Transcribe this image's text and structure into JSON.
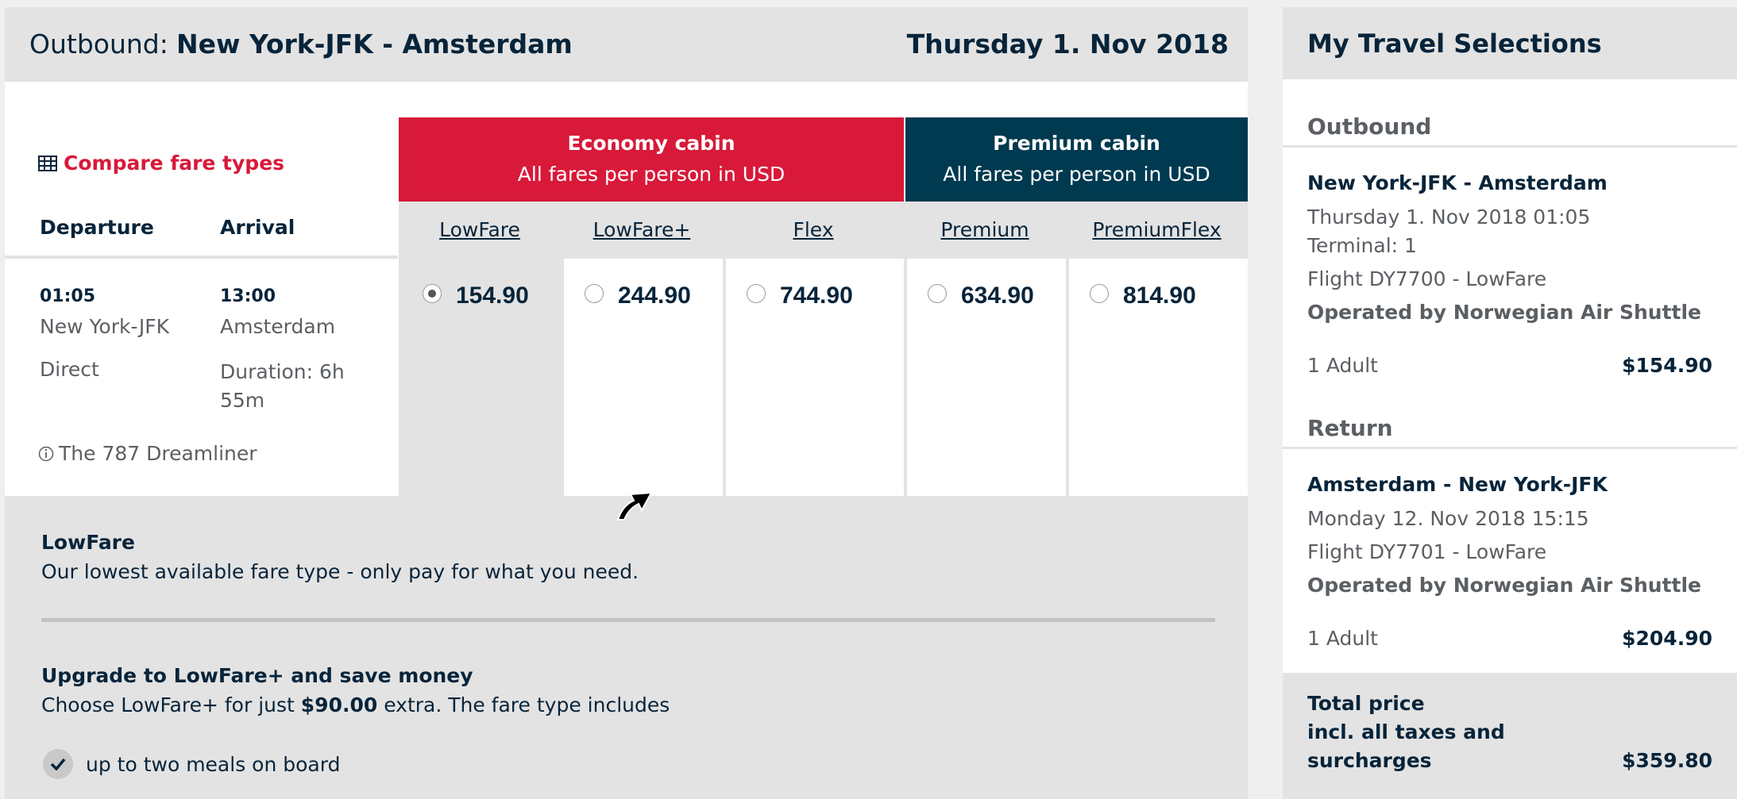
{
  "outbound": {
    "label": "Outbound",
    "route": "New York-JFK - Amsterdam",
    "date": "Thursday 1. Nov 2018"
  },
  "compare_link": "Compare fare types",
  "columns": {
    "departure": "Departure",
    "arrival": "Arrival"
  },
  "flight": {
    "dep_time": "01:05",
    "dep_city": "New York-JFK",
    "stops": "Direct",
    "arr_time": "13:00",
    "arr_city": "Amsterdam",
    "duration": "Duration: 6h 55m",
    "aircraft": "The 787 Dreamliner"
  },
  "cabins": {
    "economy": {
      "title": "Economy cabin",
      "sub": "All fares per person in USD",
      "color": "#d81939"
    },
    "premium": {
      "title": "Premium cabin",
      "sub": "All fares per person in USD",
      "color": "#003a50"
    }
  },
  "fares": [
    {
      "name": "LowFare",
      "price": "154.90",
      "selected": true
    },
    {
      "name": "LowFare+",
      "price": "244.90",
      "selected": false
    },
    {
      "name": "Flex",
      "price": "744.90",
      "selected": false
    },
    {
      "name": "Premium",
      "price": "634.90",
      "selected": false
    },
    {
      "name": "PremiumFlex",
      "price": "814.90",
      "selected": false
    }
  ],
  "fare_info": {
    "title": "LowFare",
    "desc": "Our lowest available fare type - only pay for what you need."
  },
  "upgrade": {
    "title": "Upgrade to LowFare+ and save money",
    "desc_pre": "Choose LowFare+ for just ",
    "desc_amount": "$90.00",
    "desc_post": " extra. The fare type includes",
    "features": [
      "up to two meals on board"
    ]
  },
  "selections": {
    "title": "My Travel Selections",
    "outbound": {
      "heading": "Outbound",
      "route": "New York-JFK - Amsterdam",
      "datetime": "Thursday 1. Nov 2018 01:05",
      "terminal": "Terminal: 1",
      "flight": "Flight DY7700 - LowFare",
      "operator": "Operated by Norwegian Air Shuttle",
      "pax": "1 Adult",
      "price": "$154.90"
    },
    "return": {
      "heading": "Return",
      "route": "Amsterdam - New York-JFK",
      "datetime": "Monday 12. Nov 2018 15:15",
      "flight": "Flight DY7701 - LowFare",
      "operator": "Operated by Norwegian Air Shuttle",
      "pax": "1 Adult",
      "price": "$204.90"
    },
    "total": {
      "line1": "Total price",
      "line2": "incl. all taxes and",
      "line3": "surcharges",
      "price": "$359.80"
    }
  }
}
